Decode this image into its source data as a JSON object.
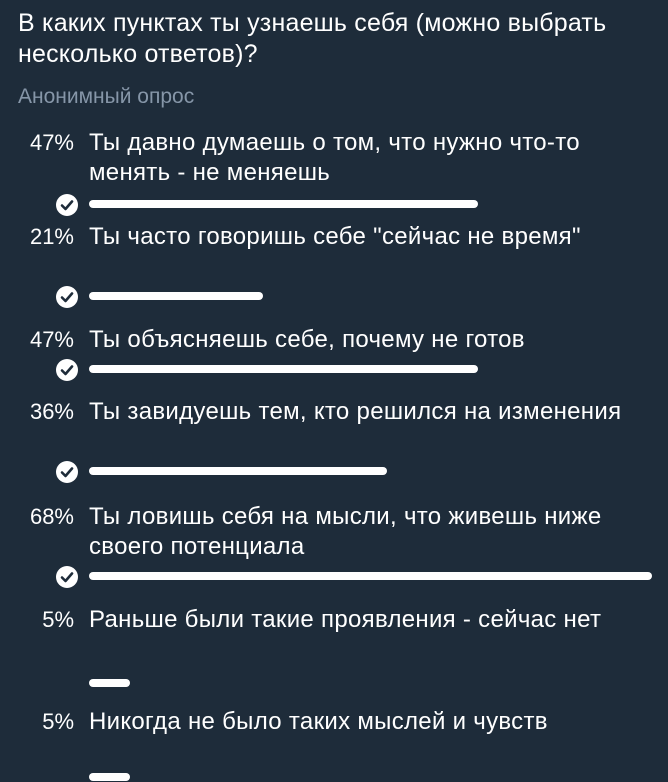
{
  "poll": {
    "question": "В каких пунктах ты узнаешь себя (можно выбрать несколько ответов)?",
    "type_label": "Анонимный опрос",
    "options": [
      {
        "percent": "47%",
        "text": "Ты давно думаешь о том, что нужно что-то менять - не меняешь",
        "value": 47,
        "chosen": true
      },
      {
        "percent": "21%",
        "text": "Ты часто говоришь себе \"сейчас не время\"",
        "value": 21,
        "chosen": true
      },
      {
        "percent": "47%",
        "text": "Ты объясняешь себе, почему не готов",
        "value": 47,
        "chosen": true
      },
      {
        "percent": "36%",
        "text": "Ты завидуешь тем, кто решился на изменения",
        "value": 36,
        "chosen": true
      },
      {
        "percent": "68%",
        "text": "Ты ловишь себя на мысли, что живешь ниже своего потенциала",
        "value": 68,
        "chosen": true
      },
      {
        "percent": "5%",
        "text": "Раньше были такие проявления - сейчас нет",
        "value": 5,
        "chosen": false
      },
      {
        "percent": "5%",
        "text": "Никогда не было таких мыслей и чувств",
        "value": 5,
        "chosen": false
      }
    ]
  },
  "colors": {
    "background": "#1e2c3a",
    "text": "#ffffff",
    "secondary_text": "#8696a8",
    "bar": "#ffffff"
  },
  "icons": {
    "chosen": "check-icon"
  }
}
